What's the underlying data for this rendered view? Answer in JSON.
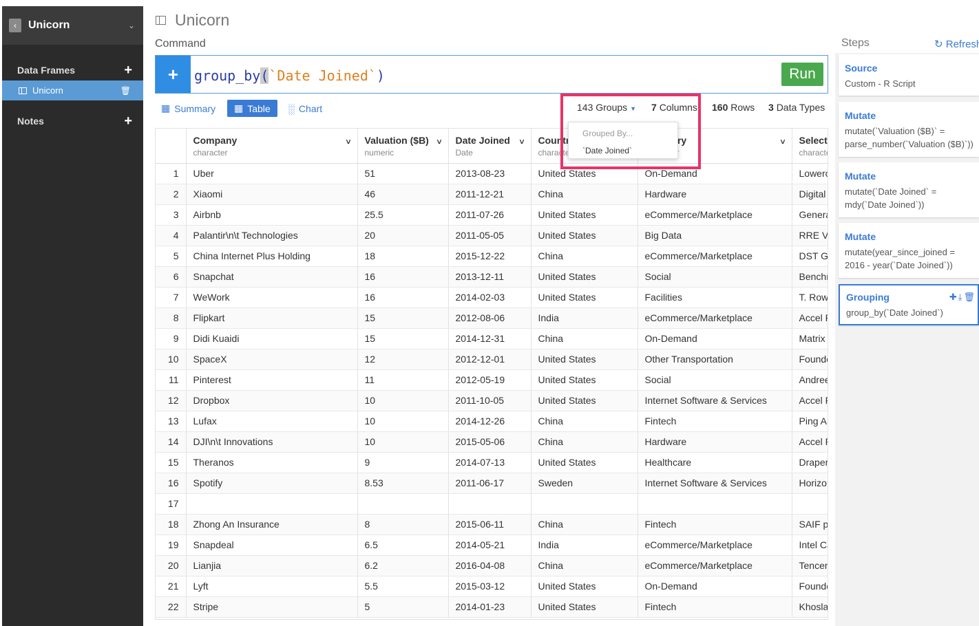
{
  "sidebar": {
    "project_title": "Unicorn",
    "data_frames_label": "Data Frames",
    "data_frames": [
      {
        "name": "Unicorn"
      }
    ],
    "notes_label": "Notes"
  },
  "main": {
    "title": "Unicorn",
    "command_label": "Command",
    "command": {
      "fn": "group_by",
      "open": "(",
      "arg": "`Date Joined`",
      "close": ")"
    },
    "run_label": "Run"
  },
  "view_tabs": [
    {
      "label": "Summary",
      "icon": "summary-grid-icon"
    },
    {
      "label": "Table",
      "icon": "table-icon"
    },
    {
      "label": "Chart",
      "icon": "bar-chart-icon"
    }
  ],
  "stats": {
    "groups": "143 Groups",
    "columns_num": "7",
    "columns_word": "Columns",
    "rows_num": "160",
    "rows_word": "Rows",
    "types_num": "3",
    "types_word": "Data Types"
  },
  "grouped_popover": {
    "header": "Grouped By...",
    "item": "`Date Joined`"
  },
  "table": {
    "columns": [
      {
        "name": "Company",
        "type": "character",
        "menu": true
      },
      {
        "name": "Valuation ($B)",
        "type": "numeric",
        "menu": true
      },
      {
        "name": "Date Joined",
        "type": "Date",
        "menu": true
      },
      {
        "name": "Country",
        "type": "character",
        "menu": false
      },
      {
        "name": "Category",
        "type": "character",
        "menu": true
      },
      {
        "name": "Select Investors",
        "type": "character",
        "menu": false
      }
    ],
    "rows": [
      [
        "1",
        "Uber",
        "51",
        "2013-08-23",
        "United States",
        "On-Demand",
        "Lowercase"
      ],
      [
        "2",
        "Xiaomi",
        "46",
        "2011-12-21",
        "China",
        "Hardware",
        "Digital"
      ],
      [
        "3",
        "Airbnb",
        "25.5",
        "2011-07-26",
        "United States",
        "eCommerce/Marketplace",
        "General"
      ],
      [
        "4",
        "Palantir\\n\\t  Technologies",
        "20",
        "2011-05-05",
        "United States",
        "Big Data",
        "RRE Ventures"
      ],
      [
        "5",
        "China Internet Plus Holding",
        "18",
        "2015-12-22",
        "China",
        "eCommerce/Marketplace",
        "DST Global"
      ],
      [
        "6",
        "Snapchat",
        "16",
        "2013-12-11",
        "United States",
        "Social",
        "Benchmark"
      ],
      [
        "7",
        "WeWork",
        "16",
        "2014-02-03",
        "United States",
        "Facilities",
        "T. Rowe"
      ],
      [
        "8",
        "Flipkart",
        "15",
        "2012-08-06",
        "India",
        "eCommerce/Marketplace",
        "Accel Partners"
      ],
      [
        "9",
        "Didi Kuaidi",
        "15",
        "2014-12-31",
        "China",
        "On-Demand",
        "Matrix"
      ],
      [
        "10",
        "SpaceX",
        "12",
        "2012-12-01",
        "United States",
        "Other Transportation",
        "Founders Fund"
      ],
      [
        "11",
        "Pinterest",
        "11",
        "2012-05-19",
        "United States",
        "Social",
        "Andreessen"
      ],
      [
        "12",
        "Dropbox",
        "10",
        "2011-10-05",
        "United States",
        "Internet Software & Services",
        "Accel Partners"
      ],
      [
        "13",
        "Lufax",
        "10",
        "2014-12-26",
        "China",
        "Fintech",
        "Ping An"
      ],
      [
        "14",
        "DJI\\n\\t  Innovations",
        "10",
        "2015-05-06",
        "China",
        "Hardware",
        "Accel Partners"
      ],
      [
        "15",
        "Theranos",
        "9",
        "2014-07-13",
        "United States",
        "Healthcare",
        "Draper"
      ],
      [
        "16",
        "Spotify",
        "8.53",
        "2011-06-17",
        "Sweden",
        "Internet Software & Services",
        "Horizons"
      ],
      [
        "17",
        "",
        "",
        "",
        "",
        "",
        ""
      ],
      [
        "18",
        "Zhong An Insurance",
        "8",
        "2015-06-11",
        "China",
        "Fintech",
        "SAIF partners"
      ],
      [
        "19",
        "Snapdeal",
        "6.5",
        "2014-05-21",
        "India",
        "eCommerce/Marketplace",
        "Intel Capital"
      ],
      [
        "20",
        "Lianjia",
        "6.2",
        "2016-04-08",
        "China",
        "eCommerce/Marketplace",
        "Tencent"
      ],
      [
        "21",
        "Lyft",
        "5.5",
        "2015-03-12",
        "United States",
        "On-Demand",
        "Founders"
      ],
      [
        "22",
        "Stripe",
        "5",
        "2014-01-23",
        "United States",
        "Fintech",
        "Khosla"
      ]
    ]
  },
  "steps_panel": {
    "title": "Steps",
    "refresh_label": "Refresh",
    "steps": [
      {
        "title": "Source",
        "desc": "Custom - R Script"
      },
      {
        "title": "Mutate",
        "desc": "mutate(`Valuation ($B)` = parse_number(`Valuation ($B)`))"
      },
      {
        "title": "Mutate",
        "desc": "mutate(`Date Joined` = mdy(`Date Joined`))"
      },
      {
        "title": "Mutate",
        "desc": "mutate(year_since_joined = 2016 - year(`Date Joined`))"
      },
      {
        "title": "Grouping",
        "desc": "group_by(`Date Joined`)"
      }
    ]
  },
  "colors": {
    "accent": "#3a7bd5",
    "run": "#4aa84f",
    "highlight": "#e8336a",
    "sidebar": "#2b2b2b",
    "selected_df": "#5b9bd5"
  }
}
